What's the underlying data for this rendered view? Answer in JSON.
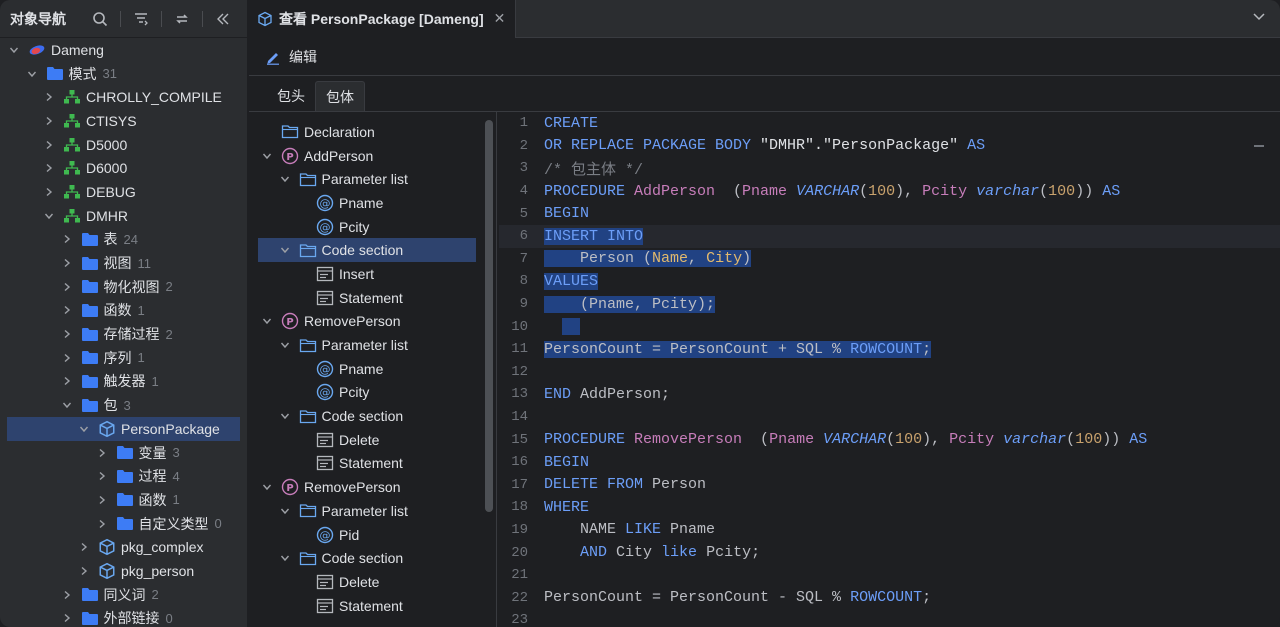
{
  "navigator": {
    "title": "对象导航",
    "tree": [
      {
        "label": "Dameng",
        "level": 0,
        "chev": "down",
        "icon": "db-icon"
      },
      {
        "label": "模式",
        "count": "31",
        "level": 1,
        "chev": "down",
        "icon": "folder-icon"
      },
      {
        "label": "CHROLLY_COMPILE",
        "level": 2,
        "chev": "right",
        "icon": "schema-icon"
      },
      {
        "label": "CTISYS",
        "level": 2,
        "chev": "right",
        "icon": "schema-icon"
      },
      {
        "label": "D5000",
        "level": 2,
        "chev": "right",
        "icon": "schema-icon"
      },
      {
        "label": "D6000",
        "level": 2,
        "chev": "right",
        "icon": "schema-icon"
      },
      {
        "label": "DEBUG",
        "level": 2,
        "chev": "right",
        "icon": "schema-icon"
      },
      {
        "label": "DMHR",
        "level": 2,
        "chev": "down",
        "icon": "schema-icon"
      },
      {
        "label": "表",
        "count": "24",
        "level": 3,
        "chev": "right",
        "icon": "folder-icon"
      },
      {
        "label": "视图",
        "count": "11",
        "level": 3,
        "chev": "right",
        "icon": "folder-icon"
      },
      {
        "label": "物化视图",
        "count": "2",
        "level": 3,
        "chev": "right",
        "icon": "folder-icon"
      },
      {
        "label": "函数",
        "count": "1",
        "level": 3,
        "chev": "right",
        "icon": "folder-icon"
      },
      {
        "label": "存储过程",
        "count": "2",
        "level": 3,
        "chev": "right",
        "icon": "folder-icon"
      },
      {
        "label": "序列",
        "count": "1",
        "level": 3,
        "chev": "right",
        "icon": "folder-icon"
      },
      {
        "label": "触发器",
        "count": "1",
        "level": 3,
        "chev": "right",
        "icon": "folder-icon"
      },
      {
        "label": "包",
        "count": "3",
        "level": 3,
        "chev": "down",
        "icon": "folder-icon"
      },
      {
        "label": "PersonPackage",
        "level": 4,
        "chev": "down",
        "icon": "package-icon",
        "selected": true
      },
      {
        "label": "变量",
        "count": "3",
        "level": 5,
        "chev": "right",
        "icon": "folder-icon"
      },
      {
        "label": "过程",
        "count": "4",
        "level": 5,
        "chev": "right",
        "icon": "folder-icon"
      },
      {
        "label": "函数",
        "count": "1",
        "level": 5,
        "chev": "right",
        "icon": "folder-icon"
      },
      {
        "label": "自定义类型",
        "count": "0",
        "level": 5,
        "chev": "right",
        "icon": "folder-icon"
      },
      {
        "label": "pkg_complex",
        "level": 4,
        "chev": "right",
        "icon": "package-icon"
      },
      {
        "label": "pkg_person",
        "level": 4,
        "chev": "right",
        "icon": "package-icon"
      },
      {
        "label": "同义词",
        "count": "2",
        "level": 3,
        "chev": "right",
        "icon": "folder-icon"
      },
      {
        "label": "外部链接",
        "count": "0",
        "level": 3,
        "chev": "right",
        "icon": "folder-icon"
      }
    ]
  },
  "tab": {
    "title": "查看 PersonPackage [Dameng]"
  },
  "toolbar": {
    "edit_label": "编辑"
  },
  "subtabs": [
    {
      "label": "包头",
      "active": false
    },
    {
      "label": "包体",
      "active": true
    }
  ],
  "outline": [
    {
      "label": "Declaration",
      "level": 0,
      "chev": "none",
      "icon": "folder-outline-icon"
    },
    {
      "label": "AddPerson",
      "level": 0,
      "chev": "down",
      "icon": "procedure-icon"
    },
    {
      "label": "Parameter list",
      "level": 1,
      "chev": "down",
      "icon": "folder-outline-icon"
    },
    {
      "label": "Pname",
      "level": 2,
      "chev": "none",
      "icon": "parameter-icon"
    },
    {
      "label": "Pcity",
      "level": 2,
      "chev": "none",
      "icon": "parameter-icon"
    },
    {
      "label": "Code section",
      "level": 1,
      "chev": "down",
      "icon": "folder-outline-icon",
      "selected": true
    },
    {
      "label": "Insert",
      "level": 2,
      "chev": "none",
      "icon": "statement-icon"
    },
    {
      "label": "Statement",
      "level": 2,
      "chev": "none",
      "icon": "statement-icon"
    },
    {
      "label": "RemovePerson",
      "level": 0,
      "chev": "down",
      "icon": "procedure-icon"
    },
    {
      "label": "Parameter list",
      "level": 1,
      "chev": "down",
      "icon": "folder-outline-icon"
    },
    {
      "label": "Pname",
      "level": 2,
      "chev": "none",
      "icon": "parameter-icon"
    },
    {
      "label": "Pcity",
      "level": 2,
      "chev": "none",
      "icon": "parameter-icon"
    },
    {
      "label": "Code section",
      "level": 1,
      "chev": "down",
      "icon": "folder-outline-icon"
    },
    {
      "label": "Delete",
      "level": 2,
      "chev": "none",
      "icon": "statement-icon"
    },
    {
      "label": "Statement",
      "level": 2,
      "chev": "none",
      "icon": "statement-icon"
    },
    {
      "label": "RemovePerson",
      "level": 0,
      "chev": "down",
      "icon": "procedure-icon"
    },
    {
      "label": "Parameter list",
      "level": 1,
      "chev": "down",
      "icon": "folder-outline-icon"
    },
    {
      "label": "Pid",
      "level": 2,
      "chev": "none",
      "icon": "parameter-icon"
    },
    {
      "label": "Code section",
      "level": 1,
      "chev": "down",
      "icon": "folder-outline-icon"
    },
    {
      "label": "Delete",
      "level": 2,
      "chev": "none",
      "icon": "statement-icon"
    },
    {
      "label": "Statement",
      "level": 2,
      "chev": "none",
      "icon": "statement-icon"
    }
  ],
  "code": [
    {
      "n": "1",
      "tokens": [
        [
          "kw",
          "CREATE"
        ]
      ]
    },
    {
      "n": "2",
      "tokens": [
        [
          "kw",
          "OR REPLACE PACKAGE BODY "
        ],
        [
          "str",
          "\"DMHR\".\"PersonPackage\" "
        ],
        [
          "kw",
          "AS"
        ]
      ]
    },
    {
      "n": "3",
      "tokens": [
        [
          "cmt",
          "/* 包主体 */"
        ]
      ]
    },
    {
      "n": "4",
      "tokens": [
        [
          "kw",
          "PROCEDURE "
        ],
        [
          "fn",
          "AddPerson"
        ],
        [
          "",
          "  ("
        ],
        [
          "fn",
          "Pname "
        ],
        [
          "ital",
          "VARCHAR"
        ],
        [
          "",
          "("
        ],
        [
          "num",
          "100"
        ],
        [
          "",
          "), "
        ],
        [
          "fn",
          "Pcity "
        ],
        [
          "ital",
          "varchar"
        ],
        [
          "",
          "("
        ],
        [
          "num",
          "100"
        ],
        [
          "",
          ")) "
        ],
        [
          "kw",
          "AS"
        ]
      ]
    },
    {
      "n": "5",
      "tokens": [
        [
          "kw",
          "BEGIN"
        ]
      ]
    },
    {
      "n": "6",
      "cur": true,
      "tokens": [
        [
          "kw hl",
          "INSERT INTO"
        ]
      ]
    },
    {
      "n": "7",
      "tokens": [
        [
          "hl",
          "    Person ("
        ],
        [
          "par hl",
          "Name"
        ],
        [
          "hl",
          ", "
        ],
        [
          "par hl",
          "City"
        ],
        [
          "hl",
          ")"
        ]
      ]
    },
    {
      "n": "8",
      "tokens": [
        [
          "kw hl",
          "VALUES"
        ]
      ]
    },
    {
      "n": "9",
      "tokens": [
        [
          "hl",
          "    (Pname, Pcity);"
        ]
      ]
    },
    {
      "n": "10",
      "tokens": [
        [
          "",
          "  "
        ],
        [
          "hl",
          "  "
        ]
      ]
    },
    {
      "n": "11",
      "tokens": [
        [
          "hl",
          "PersonCount = PersonCount + SQL % "
        ],
        [
          "kw hl",
          "ROWCOUNT"
        ],
        [
          "hl",
          ";"
        ]
      ]
    },
    {
      "n": "12",
      "tokens": []
    },
    {
      "n": "13",
      "tokens": [
        [
          "kw",
          "END "
        ],
        [
          "",
          "AddPerson;"
        ]
      ]
    },
    {
      "n": "14",
      "tokens": []
    },
    {
      "n": "15",
      "tokens": [
        [
          "kw",
          "PROCEDURE "
        ],
        [
          "fn",
          "RemovePerson"
        ],
        [
          "",
          "  ("
        ],
        [
          "fn",
          "Pname "
        ],
        [
          "ital",
          "VARCHAR"
        ],
        [
          "",
          "("
        ],
        [
          "num",
          "100"
        ],
        [
          "",
          "), "
        ],
        [
          "fn",
          "Pcity "
        ],
        [
          "ital",
          "varchar"
        ],
        [
          "",
          "("
        ],
        [
          "num",
          "100"
        ],
        [
          "",
          ")) "
        ],
        [
          "kw",
          "AS"
        ]
      ]
    },
    {
      "n": "16",
      "tokens": [
        [
          "kw",
          "BEGIN"
        ]
      ]
    },
    {
      "n": "17",
      "tokens": [
        [
          "kw",
          "DELETE FROM "
        ],
        [
          "",
          "Person"
        ]
      ]
    },
    {
      "n": "18",
      "tokens": [
        [
          "kw",
          "WHERE"
        ]
      ]
    },
    {
      "n": "19",
      "tokens": [
        [
          "",
          "    NAME "
        ],
        [
          "kw",
          "LIKE "
        ],
        [
          "",
          "Pname"
        ]
      ]
    },
    {
      "n": "20",
      "tokens": [
        [
          "",
          "    "
        ],
        [
          "kw",
          "AND "
        ],
        [
          "",
          "City "
        ],
        [
          "kw",
          "like "
        ],
        [
          "",
          "Pcity;"
        ]
      ]
    },
    {
      "n": "21",
      "tokens": []
    },
    {
      "n": "22",
      "tokens": [
        [
          "",
          "PersonCount = PersonCount - SQL % "
        ],
        [
          "kw",
          "ROWCOUNT"
        ],
        [
          "",
          ";"
        ]
      ]
    },
    {
      "n": "23",
      "tokens": []
    }
  ],
  "colors": {
    "accent": "#2e436e",
    "selection": "#214283",
    "keyword": "#6c9ef8",
    "function": "#c77dba",
    "number": "#c9a26d",
    "folder": "#3d7cf5",
    "schema": "#3fb950",
    "procedure": "#c77dba",
    "package": "#6aa8f0"
  }
}
